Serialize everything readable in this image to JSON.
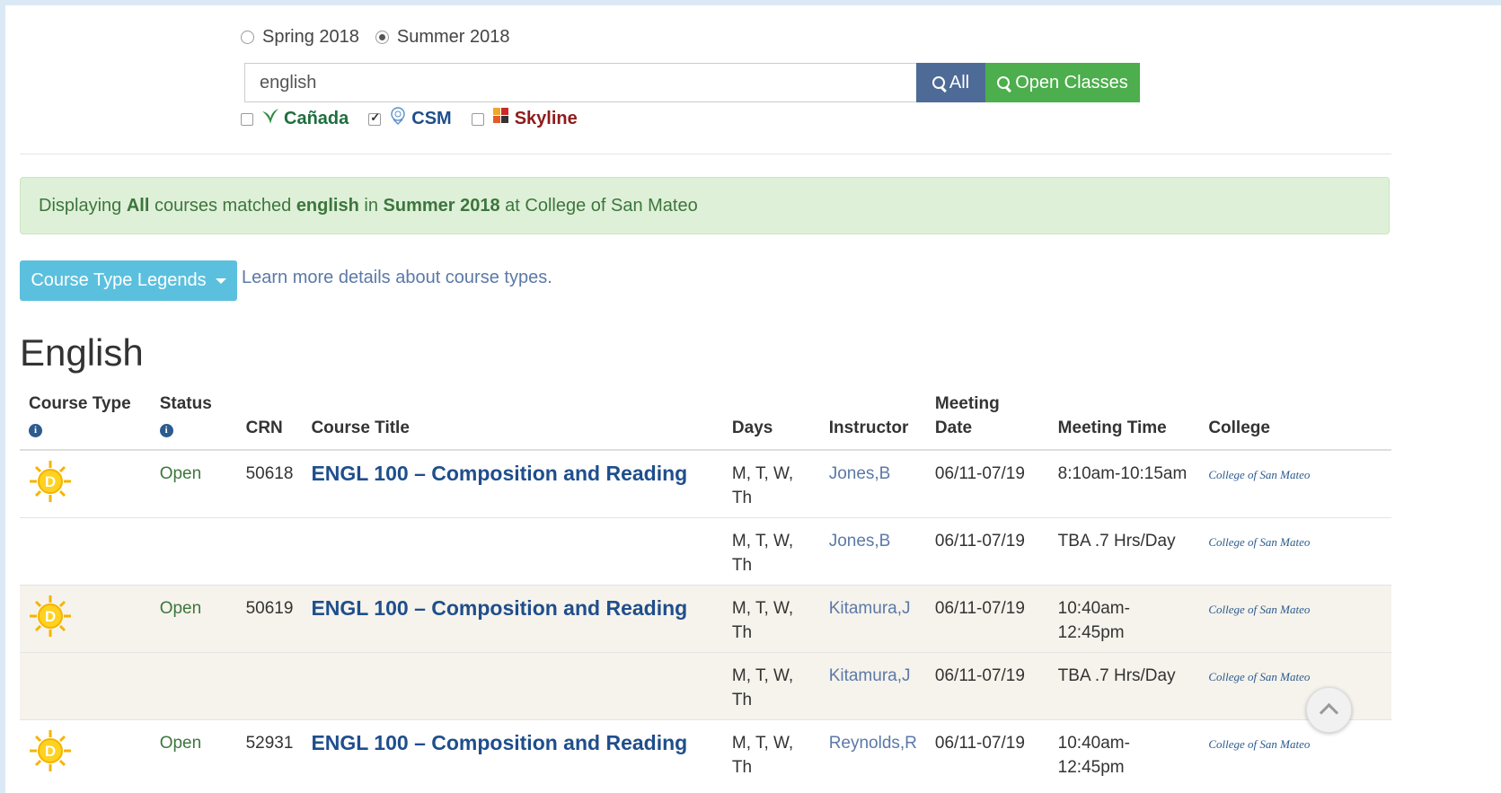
{
  "terms": [
    {
      "label": "Spring 2018",
      "checked": false
    },
    {
      "label": "Summer 2018",
      "checked": true
    }
  ],
  "search": {
    "value": "english",
    "all_label": "All",
    "open_label": "Open Classes"
  },
  "colleges": [
    {
      "label": "Cañada",
      "checked": false
    },
    {
      "label": "CSM",
      "checked": true
    },
    {
      "label": "Skyline",
      "checked": false
    }
  ],
  "alert": {
    "prefix": "Displaying ",
    "scope": "All",
    "mid1": " courses matched ",
    "query": "english",
    "mid2": " in ",
    "term": "Summer 2018",
    "suffix": " at College of San Mateo"
  },
  "legend_button": "Course Type Legends",
  "learn_link": "Learn more details about course types.",
  "section_title": "English",
  "table": {
    "headers": {
      "course_type": "Course Type",
      "status": "Status",
      "crn": "CRN",
      "course_title": "Course Title",
      "days": "Days",
      "instructor": "Instructor",
      "meeting_date_1": "Meeting",
      "meeting_date_2": "Date",
      "meeting_time": "Meeting Time",
      "college": "College"
    },
    "rows": [
      {
        "status": "Open",
        "crn": "50618",
        "title": "ENGL 100 – Composition and Reading",
        "days": "M, T, W, Th",
        "instructor": "Jones,B",
        "date": "06/11-07/19",
        "time": "8:10am-10:15am",
        "college": "College of San Mateo"
      },
      {
        "status": "",
        "crn": "",
        "title": "",
        "days": "M, T, W, Th",
        "instructor": "Jones,B",
        "date": "06/11-07/19",
        "time": "TBA .7 Hrs/Day",
        "college": "College of San Mateo"
      },
      {
        "status": "Open",
        "crn": "50619",
        "title": "ENGL 100 – Composition and Reading",
        "days": "M, T, W, Th",
        "instructor": "Kitamura,J",
        "date": "06/11-07/19",
        "time": "10:40am-12:45pm",
        "college": "College of San Mateo"
      },
      {
        "status": "",
        "crn": "",
        "title": "",
        "days": "M, T, W, Th",
        "instructor": "Kitamura,J",
        "date": "06/11-07/19",
        "time": "TBA .7 Hrs/Day",
        "college": "College of San Mateo"
      },
      {
        "status": "Open",
        "crn": "52931",
        "title": "ENGL 100 – Composition and Reading",
        "days": "M, T, W, Th",
        "instructor": "Reynolds,R",
        "date": "06/11-07/19",
        "time": "10:40am-12:45pm",
        "college": "College of San Mateo"
      }
    ]
  },
  "icons": {
    "course_type": "sun-day-icon",
    "info": "info-icon",
    "scroll_top": "chevron-up-icon"
  },
  "colors": {
    "all_button": "#4e6b97",
    "open_button": "#4cae4c",
    "legend_button": "#5bc0de",
    "alert_bg": "#dff0d8",
    "link": "#1f4e8c"
  }
}
